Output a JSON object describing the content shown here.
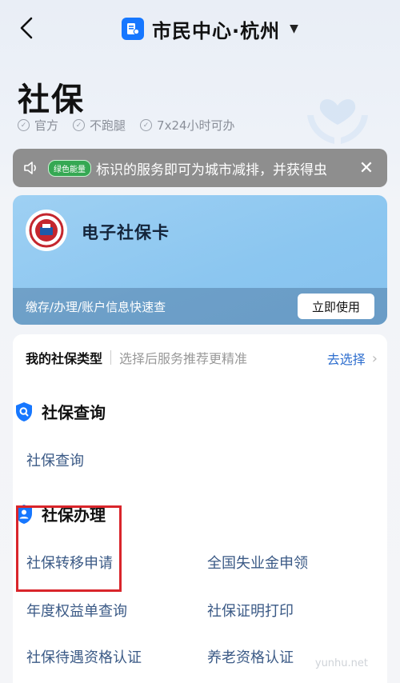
{
  "header": {
    "title": "市民中心·杭州",
    "back_icon": "chevron-left-icon",
    "dropdown_icon": "caret-down-icon"
  },
  "hero": {
    "title": "社保",
    "tags": [
      "官方",
      "不跑腿",
      "7x24小时可办"
    ]
  },
  "notice": {
    "badge": "绿色能量",
    "text": "标识的服务即可为城市减排，并获得虫",
    "close_icon": "close-icon"
  },
  "card": {
    "title": "电子社保卡",
    "subtitle": "缴存/办理/账户信息快速查",
    "button": "立即使用"
  },
  "type_row": {
    "label": "我的社保类型",
    "hint": "选择后服务推荐更精准",
    "action": "去选择"
  },
  "sections": [
    {
      "title": "社保查询",
      "items": [
        "社保查询"
      ]
    },
    {
      "title": "社保办理",
      "items": [
        "社保转移申请",
        "全国失业金申领",
        "年度权益单查询",
        "社保证明打印",
        "社保待遇资格认证",
        "养老资格认证"
      ]
    }
  ],
  "watermark": "yunhu.net",
  "colors": {
    "accent": "#1677ff",
    "link": "#2f6fcf",
    "highlight": "#d9252b"
  }
}
